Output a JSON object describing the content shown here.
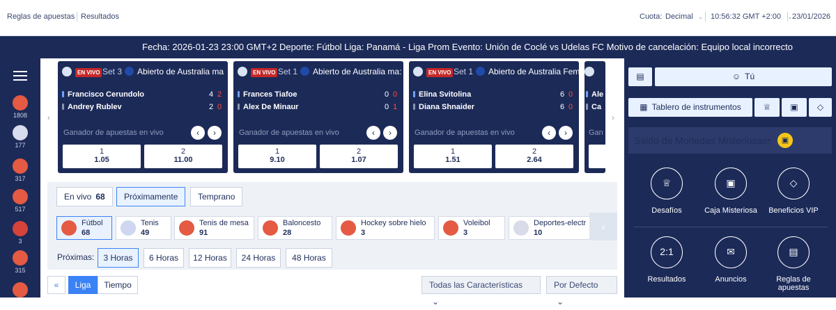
{
  "topbar": {
    "rules": "Reglas de apuestas",
    "results": "Resultados",
    "odds_label": "Cuota:",
    "odds_value": "Decimal",
    "time": "10:56:32 GMT +2:00",
    "date": "23/01/2026"
  },
  "ticker": "Fecha: 2026-01-23 23:00 GMT+2 Deporte: Fútbol Liga: Panamá - Liga Prom Evento: Unión de Coclé vs Udelas FC Motivo de cancelación: Equipo local incorrecto",
  "leftnav": [
    {
      "count": "1808",
      "color": "#e45a43"
    },
    {
      "count": "177",
      "color": "#d8dcef"
    },
    {
      "count": "317",
      "color": "#e45a43"
    },
    {
      "count": "517",
      "color": "#e45a43"
    },
    {
      "count": "3",
      "color": "#d6433a"
    },
    {
      "count": "315",
      "color": "#e45a43"
    },
    {
      "count": "",
      "color": "#e45a43"
    }
  ],
  "live_cards": [
    {
      "live": "EN VIVO",
      "set": "Set 3",
      "tournament": "Abierto de Australia ma",
      "p1": "Francisco Cerundolo",
      "p1_s1": "4",
      "p1_s2": "2",
      "p2": "Andrey Rublev",
      "p2_s1": "2",
      "p2_s2": "0",
      "market": "Ganador de apuestas en vivo",
      "o1_label": "1",
      "o1": "1.05",
      "o2_label": "2",
      "o2": "11.00"
    },
    {
      "live": "EN VIVO",
      "set": "Set 1",
      "tournament": "Abierto de Australia ma:",
      "p1": "Frances Tiafoe",
      "p1_s1": "0",
      "p1_s2": "0",
      "p2": "Alex De Minaur",
      "p2_s1": "0",
      "p2_s2": "1",
      "market": "Ganador de apuestas en vivo",
      "o1_label": "1",
      "o1": "9.10",
      "o2_label": "2",
      "o2": "1.07"
    },
    {
      "live": "EN VIVO",
      "set": "Set 1",
      "tournament": "Abierto de Australia Fem",
      "p1": "Elina Svitolina",
      "p1_s1": "6",
      "p1_s2": "0",
      "p2": "Diana Shnaider",
      "p2_s1": "6",
      "p2_s2": "0",
      "market": "Ganador de apuestas en vivo",
      "o1_label": "1",
      "o1": "1.51",
      "o2_label": "2",
      "o2": "2.64"
    },
    {
      "live": "",
      "set": "",
      "tournament": "",
      "p1": "Ale",
      "p1_s1": "",
      "p1_s2": "",
      "p2": "Ca",
      "p2_s1": "",
      "p2_s2": "",
      "market": "Gan",
      "o1_label": "",
      "o1": "",
      "o2_label": "",
      "o2": ""
    }
  ],
  "tabs": {
    "live": "En vivo",
    "live_count": "68",
    "upcoming": "Próximamente",
    "early": "Temprano"
  },
  "sports": [
    {
      "name": "Fútbol",
      "count": "68",
      "color": "#e45a43"
    },
    {
      "name": "Tenis",
      "count": "49",
      "color": "#cfd6ef"
    },
    {
      "name": "Tenis de mesa",
      "count": "91",
      "color": "#e45a43"
    },
    {
      "name": "Baloncesto",
      "count": "28",
      "color": "#e45a43"
    },
    {
      "name": "Hockey sobre hielo",
      "count": "3",
      "color": "#e45a43"
    },
    {
      "name": "Voleibol",
      "count": "3",
      "color": "#e45a43"
    },
    {
      "name": "Deportes-electr",
      "count": "10",
      "color": "#d9dce8"
    }
  ],
  "hours": {
    "label": "Próximas:",
    "options": [
      "3 Horas",
      "6 Horas",
      "12 Horas",
      "24 Horas",
      "48 Horas"
    ]
  },
  "view": {
    "league": "Liga",
    "time": "Tiempo"
  },
  "dropdowns": {
    "features": "Todas las Características",
    "sort": "Por Defecto"
  },
  "right": {
    "user": "Tú",
    "dashboard": "Tablero de instrumentos",
    "coins": "Saldo de Monedas Misteriosas:",
    "coins_value": "-",
    "tiles": [
      "Desafíos",
      "Caja Misteriosa",
      "Beneficios VIP",
      "Resultados",
      "Anuncios",
      "Reglas de apuestas"
    ],
    "results_icon_text": "2:1"
  },
  "colors": {
    "navy": "#1c2a58",
    "accent": "#3b82f6",
    "live_red": "#c62828",
    "score_red": "#ff4d3d",
    "coin_yellow": "#f5c518"
  }
}
